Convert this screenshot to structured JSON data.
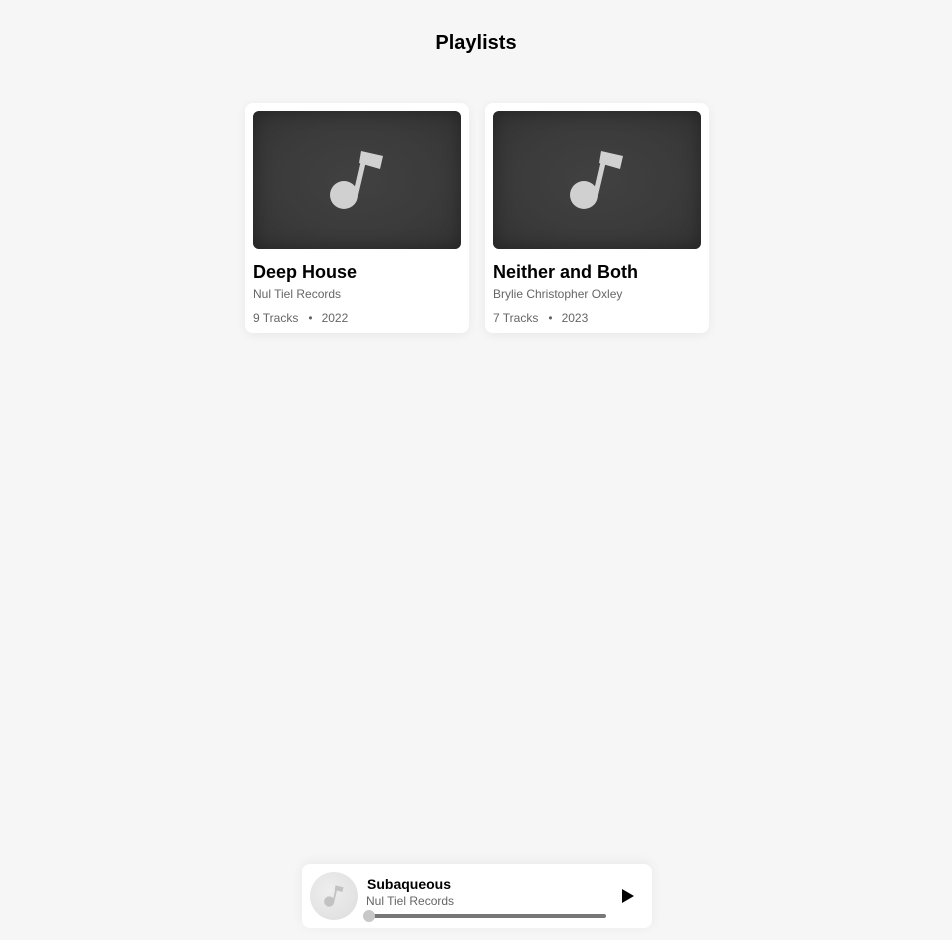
{
  "header": {
    "title": "Playlists"
  },
  "playlists": [
    {
      "title": "Deep House",
      "artist": "Nul Tiel Records",
      "tracks": "9 Tracks",
      "separator": "•",
      "year": "2022",
      "cover_icon": "music-note-icon"
    },
    {
      "title": "Neither and Both",
      "artist": "Brylie Christopher Oxley",
      "tracks": "7 Tracks",
      "separator": "•",
      "year": "2023",
      "cover_icon": "music-note-icon"
    }
  ],
  "player": {
    "title": "Subaqueous",
    "artist": "Nul Tiel Records",
    "progress": 0,
    "art_icon": "music-note-icon",
    "play_icon": "play-icon"
  },
  "colors": {
    "background": "#f6f6f6",
    "card": "#ffffff",
    "cover": "#3b3b3b",
    "note": "#d0d0d0",
    "muted_text": "#666666"
  }
}
